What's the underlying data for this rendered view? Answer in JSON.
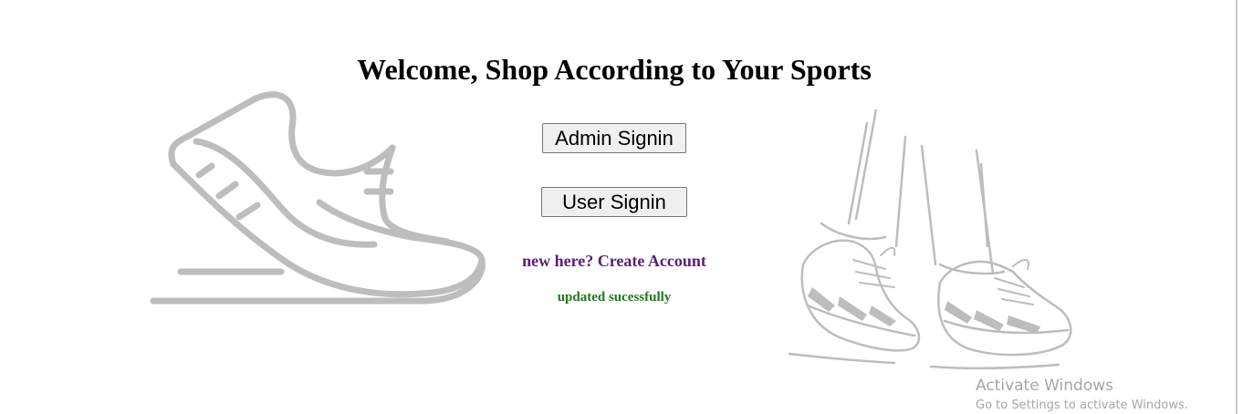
{
  "heading": "Welcome, Shop According to Your Sports",
  "buttons": {
    "admin_signin": "Admin Signin",
    "user_signin": "User Signin"
  },
  "create_account_link": "new here? Create Account",
  "status_message": "updated sucessfully",
  "illustrations": {
    "left": "running-shoe-icon",
    "right": "walking-sneakers-icon"
  },
  "colors": {
    "link": "#5a1e78",
    "status": "#1f7a1f",
    "illustration": "#bdbdbd"
  },
  "watermark": {
    "title": "Activate Windows",
    "subtitle": "Go to Settings to activate Windows."
  }
}
